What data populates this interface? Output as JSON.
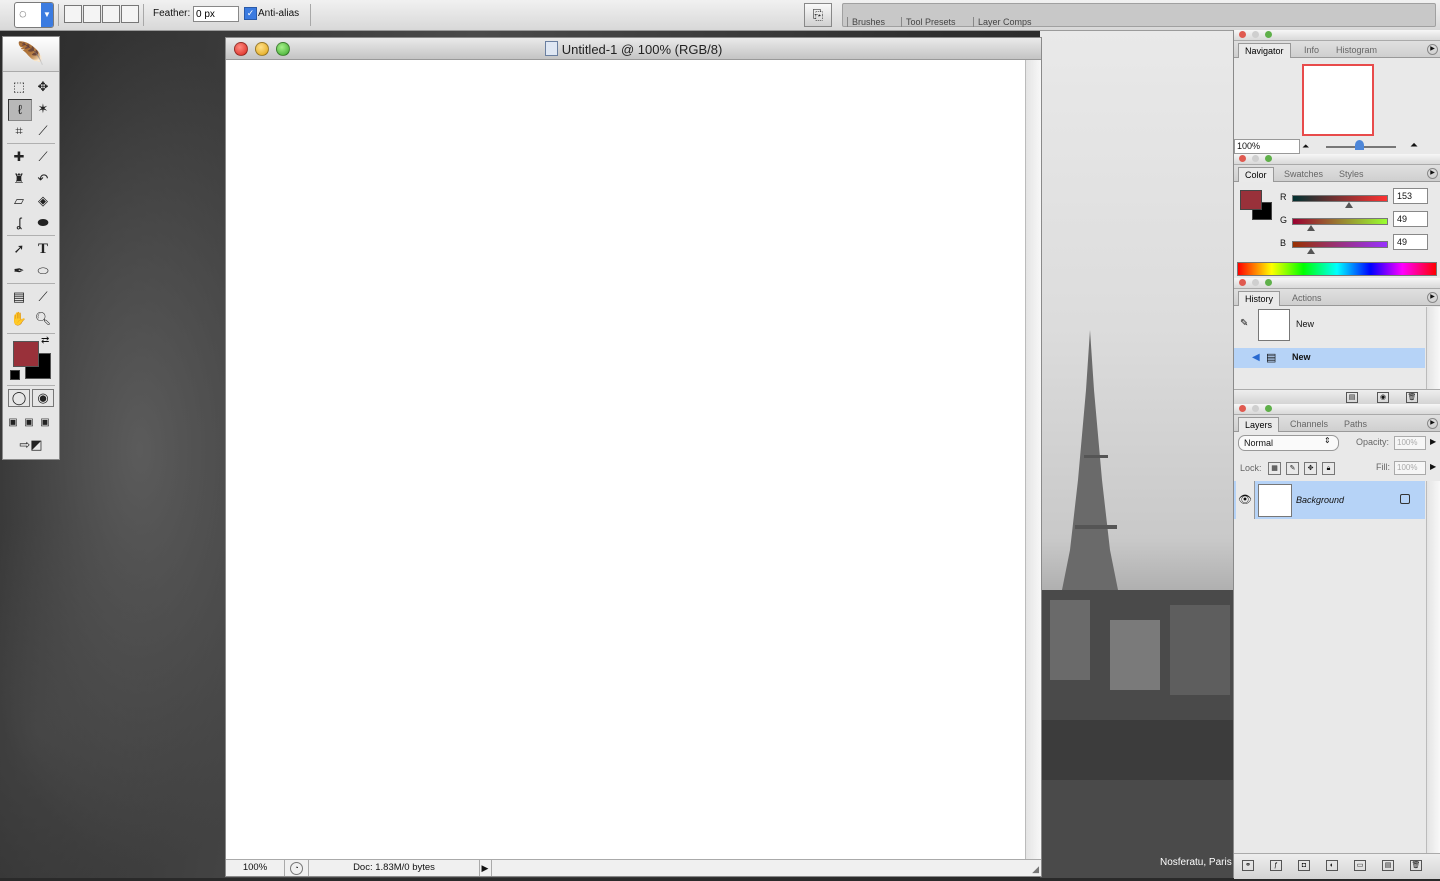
{
  "options_bar": {
    "feather_label": "Feather:",
    "feather_value": "0 px",
    "antialias_label": "Anti-alias",
    "antialias_checked": true,
    "palette_well_tabs": [
      "Brushes",
      "Tool Presets",
      "Layer Comps"
    ]
  },
  "toolbox": {
    "tools": [
      "marquee-icon",
      "move-icon",
      "lasso-icon",
      "magic-wand-icon",
      "crop-icon",
      "slice-icon",
      "healing-brush-icon",
      "brush-icon",
      "clone-stamp-icon",
      "history-brush-icon",
      "eraser-icon",
      "paint-bucket-icon",
      "blur-icon",
      "dodge-icon",
      "path-selection-icon",
      "type-icon",
      "pen-icon",
      "shape-icon",
      "notes-icon",
      "eyedropper-icon",
      "hand-icon",
      "zoom-icon"
    ],
    "type_glyph": "T",
    "foreground_color": "#99313a",
    "background_color": "#000000"
  },
  "document": {
    "title": "Untitled-1 @ 100% (RGB/8)",
    "zoom": "100%",
    "doc_info": "Doc: 1.83M/0 bytes"
  },
  "navigator": {
    "tabs": [
      "Navigator",
      "Info",
      "Histogram"
    ],
    "zoom": "100%"
  },
  "color_palette": {
    "tabs": [
      "Color",
      "Swatches",
      "Styles"
    ],
    "channels": [
      {
        "label": "R",
        "value": "153"
      },
      {
        "label": "G",
        "value": "49"
      },
      {
        "label": "B",
        "value": "49"
      }
    ]
  },
  "history": {
    "tabs": [
      "History",
      "Actions"
    ],
    "snapshot_label": "New",
    "step_label": "New"
  },
  "layers": {
    "tabs": [
      "Layers",
      "Channels",
      "Paths"
    ],
    "blend_mode": "Normal",
    "opacity_label": "Opacity:",
    "opacity_value": "100%",
    "lock_label": "Lock:",
    "fill_label": "Fill:",
    "fill_value": "100%",
    "layer_name": "Background"
  },
  "desktop": {
    "caption": "Nosferatu, Paris"
  }
}
